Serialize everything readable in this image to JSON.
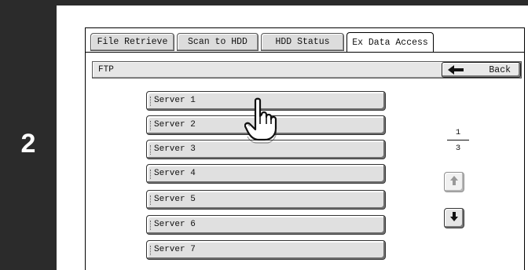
{
  "step": {
    "number": "2"
  },
  "tabs": [
    {
      "label": "File Retrieve",
      "active": false
    },
    {
      "label": "Scan to HDD",
      "active": false
    },
    {
      "label": "HDD Status",
      "active": false
    },
    {
      "label": "Ex Data Access",
      "active": true
    }
  ],
  "path": {
    "label": "FTP"
  },
  "back": {
    "label": "Back",
    "icon": "arrow-left-icon"
  },
  "servers": [
    {
      "label": "Server 1"
    },
    {
      "label": "Server 2"
    },
    {
      "label": "Server 3"
    },
    {
      "label": "Server 4"
    },
    {
      "label": "Server 5"
    },
    {
      "label": "Server 6"
    },
    {
      "label": "Server 7"
    }
  ],
  "pager": {
    "current": "1",
    "total": "3",
    "up_icon": "arrow-up-icon",
    "down_icon": "arrow-down-icon"
  },
  "colors": {
    "sidebar": "#2b2b2b",
    "button_face": "#e0e0e0",
    "text": "#111111"
  }
}
